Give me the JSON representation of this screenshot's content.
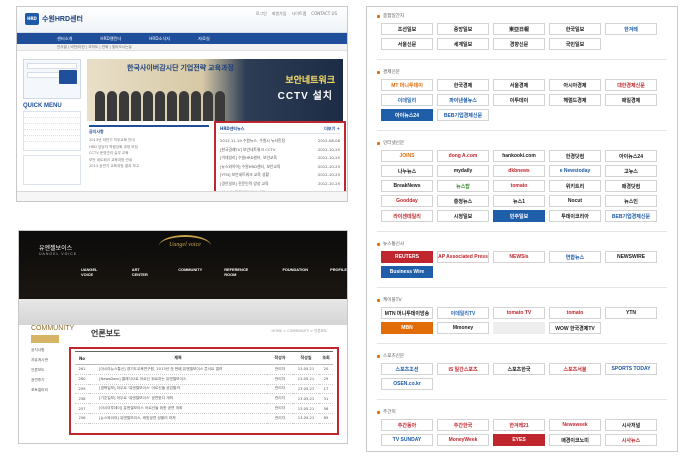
{
  "hrd": {
    "logo_mark": "HRD",
    "logo": "수원HRD센터",
    "toplinks": [
      "로그인",
      "회원가입",
      "사이트맵",
      "CONTACT US"
    ],
    "nav": [
      "센터소개",
      "HRD캘린더",
      "HRD소식지",
      "자료실"
    ],
    "subnav": "인사말 | 비전/미션 | 조직도 | 연혁 | 찾아오시는길",
    "banner_title": "한국사이버감시단 기업전략 교육과정",
    "banner_highlight": "보안네트워크",
    "banner_sub": "CCTV 설치",
    "quick": "QUICK MENU",
    "board_title": "공지사항",
    "board_rows": [
      "2013년 하반기 직무교육 안내",
      "HRD 담당자 역량강화 과정 모집",
      "CCTV 운영관리 실무 교육",
      "보안 네트워크 교육과정 안내",
      "2013 상반기 교육과정 결과 보고"
    ],
    "news_title": "HRD센터뉴스",
    "news_more": "더보기 +",
    "news_rows": [
      {
        "title": "2012.11.19 수원뉴스, 수원시 뉴서민정",
        "date": "2012-08-08"
      },
      {
        "title": "[한국경제TV] 보안네트워크 CCTV",
        "date": "2012-10-25"
      },
      {
        "title": "[이데일리] 수원HRD센터, 보안교육",
        "date": "2012-10-25"
      },
      {
        "title": "[뉴스와이어] 수원HRD센터, 보안교육",
        "date": "2012-10-25"
      },
      {
        "title": "[YTN] 보안네트워크 교육 성황",
        "date": "2012-10-25"
      },
      {
        "title": "[경인일보] 전문인력 양성 교육",
        "date": "2012-10-25"
      },
      {
        "title": "[한겨레] 전문인력 양성 과정",
        "date": "2012-10-25"
      }
    ]
  },
  "uv": {
    "logo": "유엔젤보이스",
    "logo_en": "UANGEL VOICE",
    "crest": "Uangel voice",
    "nav": [
      "UANGEL VOICE",
      "ART CENTER",
      "COMMUNITY",
      "REFERENCE ROOM",
      "FOUNDATION",
      "PROFILE"
    ],
    "community": "COMMUNITY",
    "side_items": [
      "공지사항",
      "자유게시판",
      "언론보도",
      "공연후기",
      "포토갤러리"
    ],
    "page_title": "언론보도",
    "crumb": "HOME > COMMUNITY > 언론보도",
    "headers": [
      "No",
      "제목",
      "작성자",
      "작성일",
      "조회"
    ],
    "rows": [
      [
        "261",
        "[아시아뉴스통신] 경기도교육연구원, 2013년 첫 번째 유엔젤보이스 콘서트 열려",
        "관리자",
        "13.05.21",
        "20"
      ],
      [
        "260",
        "[NewsDam] 클래식으로 어르신 위로하는 유엔젤보이스",
        "관리자",
        "13.05.21",
        "29"
      ],
      [
        "259",
        "[경북일보] 어우르 '유엔젤보이스' 어르신들 공감할까",
        "관리자",
        "13.05.21",
        "17"
      ],
      [
        "258",
        "[기호일보] 어우르 '유엔젤보이스' 공연한다 개최",
        "관리자",
        "13.05.21",
        "31"
      ],
      [
        "257",
        "[아시아투데이] 유엔젤보이스 어르신들 위한 공연 개최",
        "관리자",
        "13.05.21",
        "56"
      ],
      [
        "256",
        "[뉴스와이어] 유엔젤보이스, 희망공연 성황리 마쳐",
        "관리자",
        "13.05.21",
        "85"
      ]
    ]
  },
  "media": {
    "sections": [
      {
        "title": "종합일간지",
        "tiles": [
          {
            "text": "조선일보",
            "color": "#1a1a1a"
          },
          {
            "text": "중앙일보",
            "color": "#1a1a1a"
          },
          {
            "text": "東亞日報",
            "color": "#1a1a1a"
          },
          {
            "text": "한국일보",
            "color": "#1a1a1a"
          },
          {
            "text": "한겨레",
            "color": "#1a5aa8"
          },
          {
            "text": "서울신문",
            "color": "#1a1a1a"
          },
          {
            "text": "세계일보",
            "color": "#1a1a1a"
          },
          {
            "text": "경향신문",
            "color": "#1a1a1a"
          },
          {
            "text": "국민일보",
            "color": "#1a1a1a"
          }
        ]
      },
      {
        "title": "경제신문",
        "tiles": [
          {
            "text": "MT 머니투데이",
            "color": "#e36c0a"
          },
          {
            "text": "한국경제",
            "color": "#1a1a1a"
          },
          {
            "text": "서울경제",
            "color": "#1a1a1a"
          },
          {
            "text": "아시아경제",
            "color": "#1a1a1a"
          },
          {
            "text": "대한경제신문",
            "color": "#c0262d"
          },
          {
            "text": "이데일리",
            "color": "#2b6bb5"
          },
          {
            "text": "파이낸셜뉴스",
            "color": "#1a5aa8"
          },
          {
            "text": "이투데이",
            "color": "#1a1a1a"
          },
          {
            "text": "헤럴드경제",
            "color": "#1a1a1a"
          },
          {
            "text": "매일경제",
            "color": "#1a1a1a"
          },
          {
            "text": "아이뉴스24",
            "color": "#ffffff",
            "bg": "#1f5ea8"
          },
          {
            "text": "BEB기업경제신문",
            "color": "#1a5aa8"
          }
        ]
      },
      {
        "title": "인터넷신문",
        "tiles": [
          {
            "text": "JOINS",
            "color": "#e36c0a"
          },
          {
            "text": "dong A.com",
            "color": "#c0262d"
          },
          {
            "text": "hankooki.com",
            "color": "#1a1a1a"
          },
          {
            "text": "한경닷컴",
            "color": "#1a1a1a"
          },
          {
            "text": "아이뉴스24",
            "color": "#1a1a1a"
          },
          {
            "text": "나누뉴스",
            "color": "#1a1a1a"
          },
          {
            "text": "mydaily",
            "color": "#1a1a1a"
          },
          {
            "text": "dkbnews",
            "color": "#c0262d"
          },
          {
            "text": "e Newstoday",
            "color": "#1a5aa8"
          },
          {
            "text": "고뉴스",
            "color": "#1a1a1a"
          },
          {
            "text": "BreakNews",
            "color": "#1a1a1a"
          },
          {
            "text": "뉴스탑",
            "color": "#3a8a2a"
          },
          {
            "text": "tomato",
            "color": "#c0262d"
          },
          {
            "text": "위키트리",
            "color": "#1a1a1a"
          },
          {
            "text": "매경닷컴",
            "color": "#1a1a1a"
          },
          {
            "text": "Goodday",
            "color": "#c0262d"
          },
          {
            "text": "충청뉴스",
            "color": "#1a1a1a"
          },
          {
            "text": "뉴스1",
            "color": "#1a1a1a"
          },
          {
            "text": "Nocut",
            "color": "#1a1a1a"
          },
          {
            "text": "뉴스인",
            "color": "#1a1a1a"
          },
          {
            "text": "라이센데일리",
            "color": "#c0262d"
          },
          {
            "text": "시정일보",
            "color": "#1a1a1a"
          },
          {
            "text": "민주일보",
            "color": "#ffffff",
            "bg": "#1f5ea8"
          },
          {
            "text": "투데이코리아",
            "color": "#1a1a1a"
          },
          {
            "text": "BEB기업경제신문",
            "color": "#1a5aa8"
          }
        ]
      },
      {
        "title": "뉴스통신사",
        "tiles": [
          {
            "text": "REUTERS",
            "color": "#ffffff",
            "bg": "#c0262d"
          },
          {
            "text": "AP Associated Press",
            "color": "#c0262d"
          },
          {
            "text": "NEWSis",
            "color": "#c0262d"
          },
          {
            "text": "연합뉴스",
            "color": "#1a5aa8"
          },
          {
            "text": "NEWSWIRE",
            "color": "#1a1a1a"
          },
          {
            "text": "Business Wire",
            "color": "#ffffff",
            "bg": "#1f5ea8"
          }
        ]
      },
      {
        "title": "케이블TV",
        "tiles": [
          {
            "text": "MTN 머니투데이방송",
            "color": "#1a1a1a"
          },
          {
            "text": "이데일리TV",
            "color": "#2b6bb5"
          },
          {
            "text": "tomato TV",
            "color": "#c0262d"
          },
          {
            "text": "tomato",
            "color": "#c0262d"
          },
          {
            "text": "YTN",
            "color": "#1a1a1a"
          },
          {
            "text": "MBN",
            "color": "#ffffff",
            "bg": "#e36c0a"
          },
          {
            "text": "Mmoney",
            "color": "#1a1a1a"
          },
          {
            "text": "",
            "color": "#999999",
            "bg": "#eeeeee"
          },
          {
            "text": "WOW 한국경제TV",
            "color": "#1a1a1a"
          }
        ]
      },
      {
        "title": "스포츠신문",
        "tiles": [
          {
            "text": "스포츠조선",
            "color": "#1a5aa8"
          },
          {
            "text": "IS 일간스포츠",
            "color": "#c0262d"
          },
          {
            "text": "스포츠한국",
            "color": "#1a1a1a"
          },
          {
            "text": "스포츠서울",
            "color": "#c0262d"
          },
          {
            "text": "SPORTS TODAY",
            "color": "#1a5aa8"
          },
          {
            "text": "OSEN.co.kr",
            "color": "#1a5aa8"
          }
        ]
      },
      {
        "title": "주간지",
        "tiles": [
          {
            "text": "주간동아",
            "color": "#c0262d"
          },
          {
            "text": "주간한국",
            "color": "#c0262d"
          },
          {
            "text": "한겨레21",
            "color": "#c0262d"
          },
          {
            "text": "Newsweek",
            "color": "#c0262d"
          },
          {
            "text": "시사저널",
            "color": "#1a1a1a"
          },
          {
            "text": "TV SUNDAY",
            "color": "#1a5aa8"
          },
          {
            "text": "MoneyWeek",
            "color": "#c0262d"
          },
          {
            "text": "EYES",
            "color": "#ffffff",
            "bg": "#c0262d"
          },
          {
            "text": "매경이코노미",
            "color": "#1a1a1a"
          },
          {
            "text": "시사뉴스",
            "color": "#c0262d"
          }
        ]
      }
    ]
  }
}
